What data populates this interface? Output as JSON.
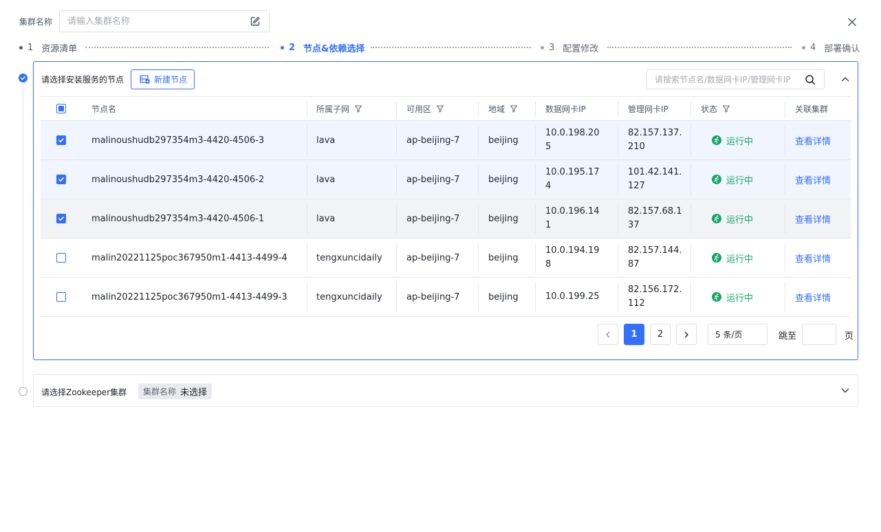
{
  "header": {
    "cluster_name_label": "集群名称",
    "cluster_name_placeholder": "请输入集群名称",
    "cluster_name_value": ""
  },
  "steps": [
    {
      "num": "1",
      "label": "资源清单",
      "state": "done"
    },
    {
      "num": "2",
      "label": "节点&依赖选择",
      "state": "active"
    },
    {
      "num": "3",
      "label": "配置修改",
      "state": "pending"
    },
    {
      "num": "4",
      "label": "部署确认",
      "state": "pending"
    }
  ],
  "node_section": {
    "title": "请选择安装服务的节点",
    "new_node_label": "新建节点",
    "search_placeholder": "请搜索节点名/数据网卡IP/管理网卡IP",
    "search_value": "",
    "columns": {
      "name": "节点名",
      "subnet": "所属子网",
      "zone": "可用区",
      "region": "地域",
      "data_ip": "数据网卡IP",
      "mgmt_ip": "管理网卡IP",
      "status": "状态",
      "cluster": "关联集群"
    },
    "rows": [
      {
        "selected": true,
        "name": "malinoushudb297354m3-4420-4506-3",
        "subnet": "lava",
        "zone": "ap-beijing-7",
        "region": "beijing",
        "data_ip": "10.0.198.205",
        "mgmt_ip": "82.157.137.210",
        "status": "运行中",
        "action": "查看详情"
      },
      {
        "selected": true,
        "name": "malinoushudb297354m3-4420-4506-2",
        "subnet": "lava",
        "zone": "ap-beijing-7",
        "region": "beijing",
        "data_ip": "10.0.195.174",
        "mgmt_ip": "101.42.141.127",
        "status": "运行中",
        "action": "查看详情"
      },
      {
        "selected": true,
        "name": "malinoushudb297354m3-4420-4506-1",
        "subnet": "lava",
        "zone": "ap-beijing-7",
        "region": "beijing",
        "data_ip": "10.0.196.141",
        "mgmt_ip": "82.157.68.137",
        "status": "运行中",
        "action": "查看详情"
      },
      {
        "selected": false,
        "name": "malin20221125poc367950m1-4413-4499-4",
        "subnet": "tengxuncidaily",
        "zone": "ap-beijing-7",
        "region": "beijing",
        "data_ip": "10.0.194.198",
        "mgmt_ip": "82.157.144.87",
        "status": "运行中",
        "action": "查看详情"
      },
      {
        "selected": false,
        "name": "malin20221125poc367950m1-4413-4499-3",
        "subnet": "tengxuncidaily",
        "zone": "ap-beijing-7",
        "region": "beijing",
        "data_ip": "10.0.199.25",
        "mgmt_ip": "82.156.172.112",
        "status": "运行中",
        "action": "查看详情"
      }
    ],
    "pagination": {
      "pages": [
        "1",
        "2"
      ],
      "current": "1",
      "page_size": "5 条/页",
      "jump_label": "跳至",
      "jump_value": "",
      "page_suffix": "页"
    }
  },
  "zookeeper_section": {
    "title": "请选择Zookeeper集群",
    "tag_key": "集群名称",
    "tag_value": "未选择"
  },
  "colors": {
    "accent": "#3370ff",
    "running": "#17a668",
    "border": "#e5e6eb",
    "selected_row": "#f0f5ff"
  }
}
